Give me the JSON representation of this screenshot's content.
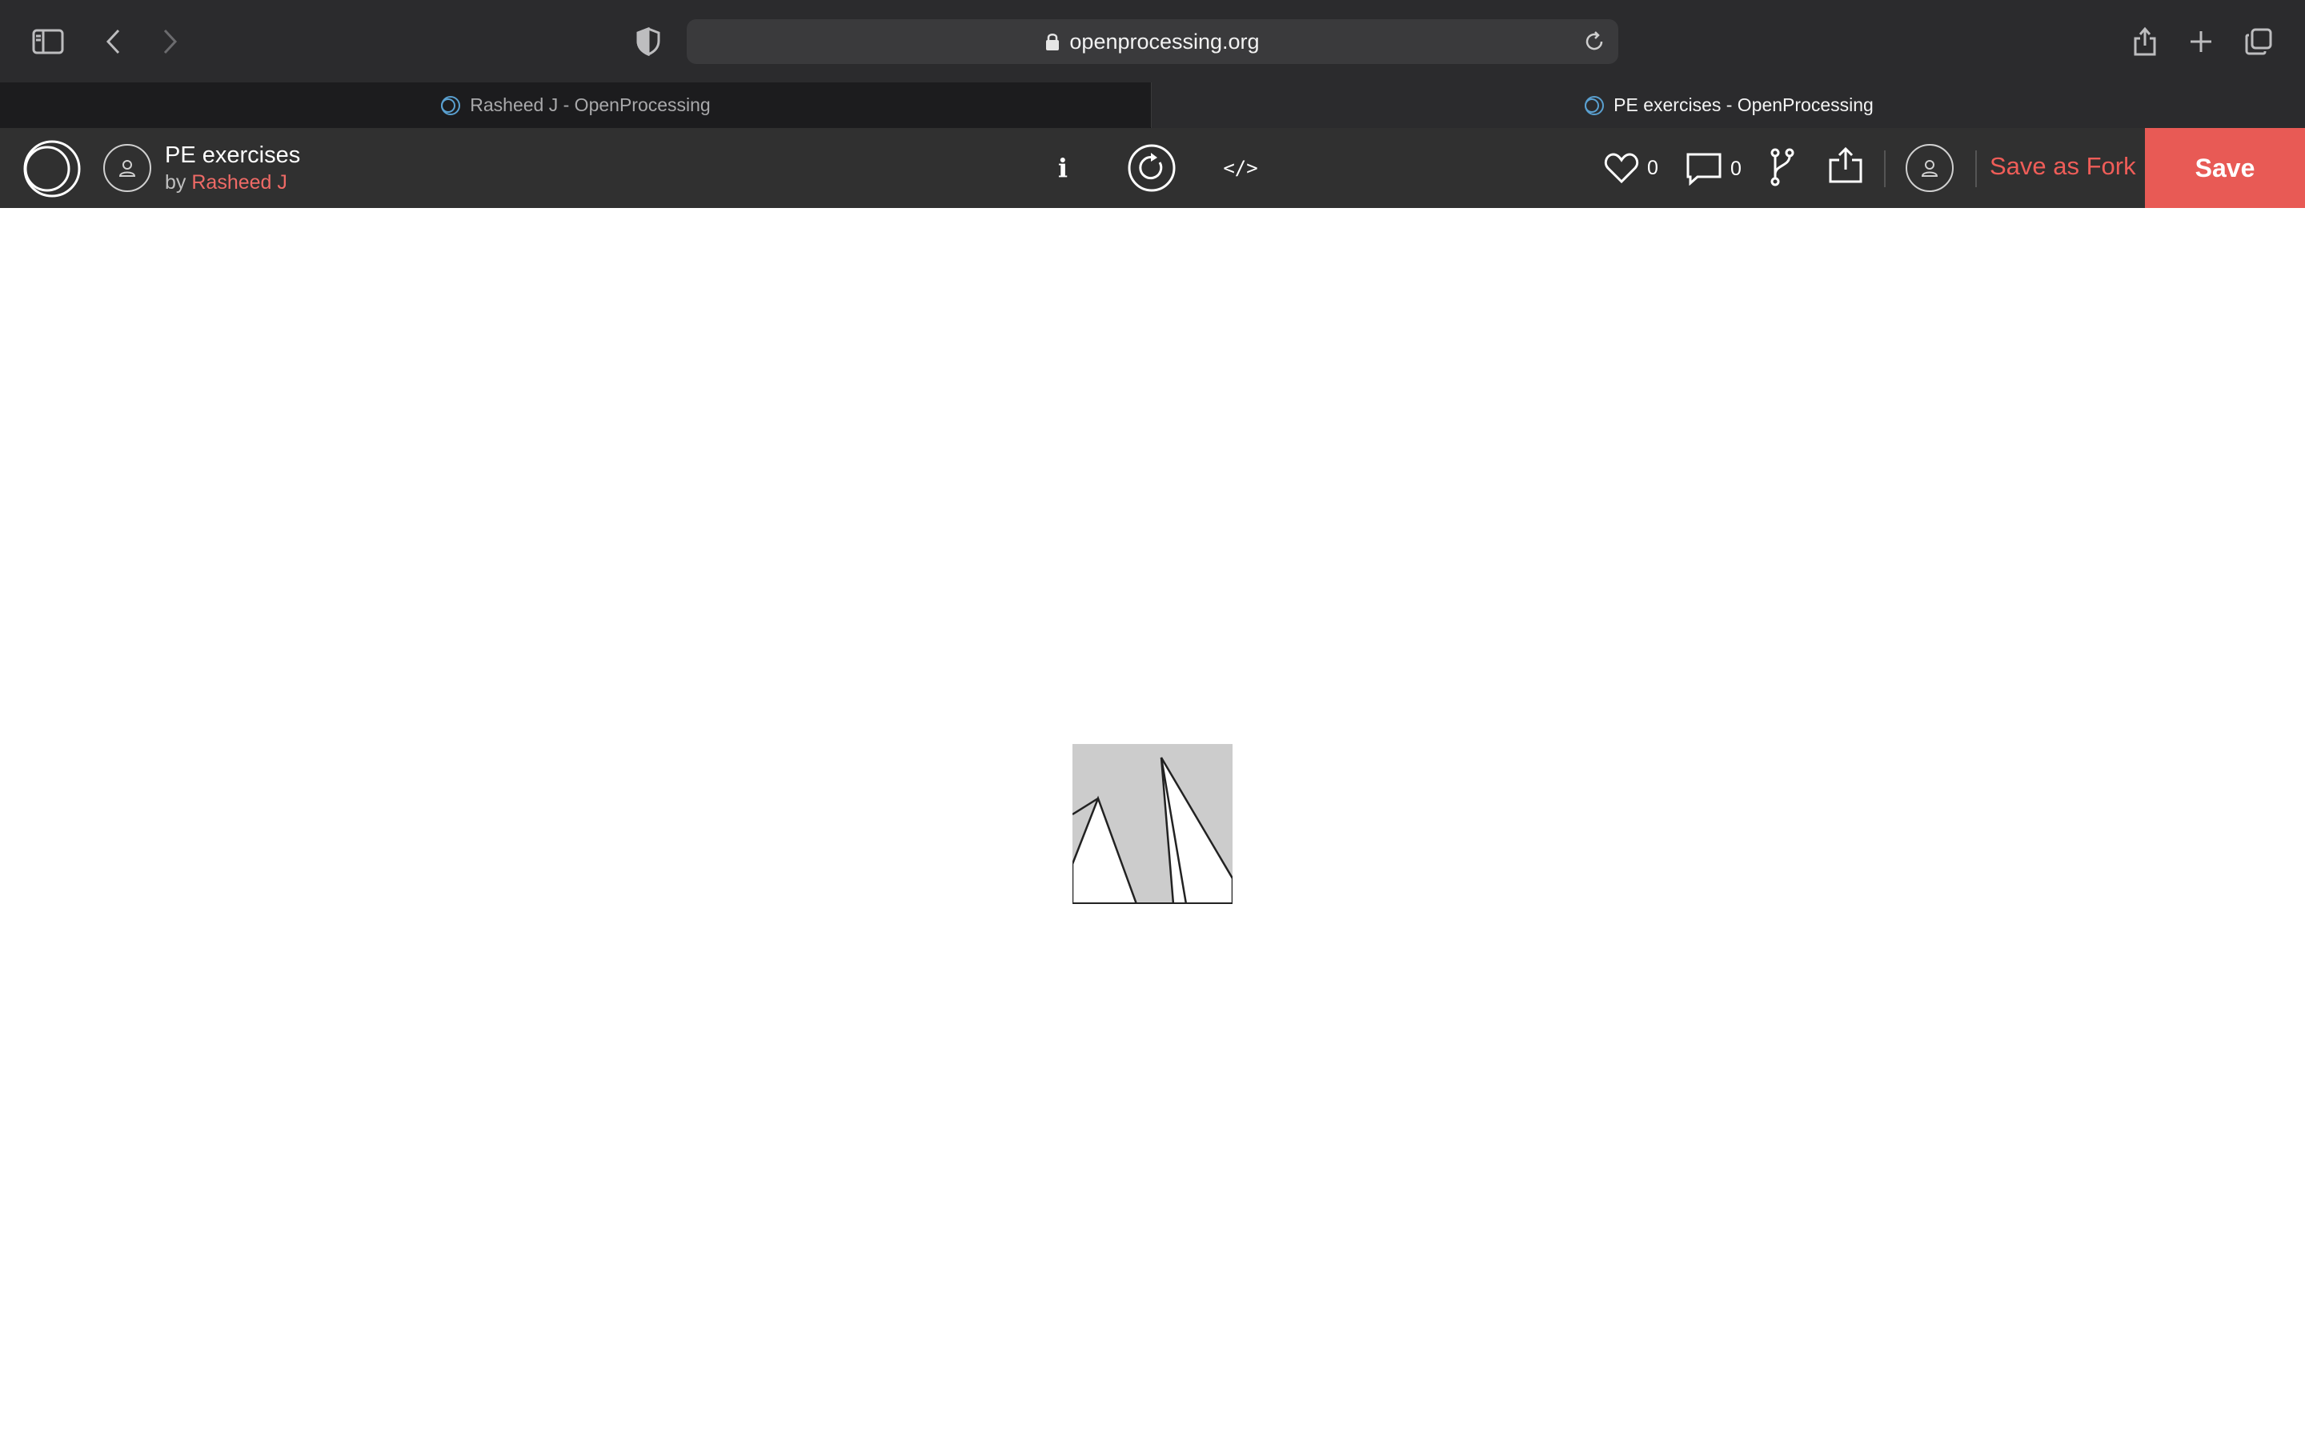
{
  "browser": {
    "url": "openprocessing.org",
    "tabs": [
      {
        "title": "Rasheed J - OpenProcessing",
        "active": false
      },
      {
        "title": "PE exercises - OpenProcessing",
        "active": true
      }
    ],
    "icons": {
      "sidebar": "sidebar-icon",
      "back": "chevron-left-icon",
      "forward": "chevron-right-icon",
      "privacy": "shield-icon",
      "lock": "lock-icon",
      "reload": "reload-icon",
      "share": "share-icon",
      "new_tab": "plus-icon",
      "tab_overview": "tabs-overview-icon"
    }
  },
  "sketch": {
    "title": "PE exercises",
    "by_prefix": "by",
    "author": "Rasheed J",
    "likes": "0",
    "comments": "0",
    "info_label": "i",
    "code_label": "</>",
    "fork_label": "Save as Fork",
    "save_label": "Save"
  },
  "colors": {
    "browser_toolbar": "#2b2b2d",
    "op_header": "#303030",
    "accent_red": "#e85a55",
    "author_link": "#ef6a66",
    "canvas_background": "#cccccc"
  }
}
